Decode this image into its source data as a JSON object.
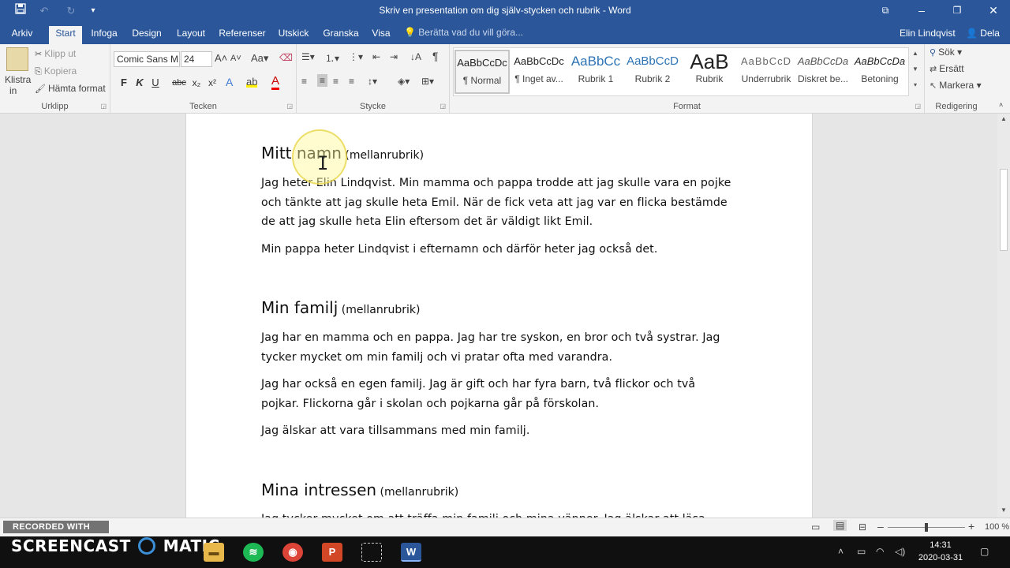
{
  "window": {
    "title": "Skriv en presentation om dig själv-stycken och rubrik - Word",
    "save_icon": "save-icon",
    "undo_icon": "undo-icon",
    "redo_icon": "redo-icon"
  },
  "tabs": [
    {
      "label": "Arkiv"
    },
    {
      "label": "Start"
    },
    {
      "label": "Infoga"
    },
    {
      "label": "Design"
    },
    {
      "label": "Layout"
    },
    {
      "label": "Referenser"
    },
    {
      "label": "Utskick"
    },
    {
      "label": "Granska"
    },
    {
      "label": "Visa"
    }
  ],
  "tellme": "Berätta vad du vill göra...",
  "user": {
    "name": "Elin Lindqvist",
    "share_label": "Dela"
  },
  "ribbon": {
    "clipboard": {
      "paste_label": "Klistra",
      "paste_sub": "in",
      "cut": "Klipp ut",
      "copy": "Kopiera",
      "format_painter": "Hämta format",
      "group": "Urklipp"
    },
    "font": {
      "name": "Comic Sans M",
      "size": "24",
      "group": "Tecken",
      "bold": "F",
      "italic": "K",
      "underline": "U",
      "strike": "abc",
      "subscript": "x₂",
      "superscript": "x²"
    },
    "paragraph": {
      "group": "Stycke"
    },
    "styles": {
      "group": "Format",
      "items": [
        {
          "preview": "AaBbCcDc",
          "name": "¶ Normal"
        },
        {
          "preview": "AaBbCcDc",
          "name": "¶ Inget av..."
        },
        {
          "preview": "AaBbCc",
          "name": "Rubrik 1"
        },
        {
          "preview": "AaBbCcD",
          "name": "Rubrik 2"
        },
        {
          "preview": "AaB",
          "name": "Rubrik"
        },
        {
          "preview": "AaBbCcD",
          "name": "Underrubrik"
        },
        {
          "preview": "AaBbCcDa",
          "name": "Diskret be..."
        },
        {
          "preview": "AaBbCcDa",
          "name": "Betoning"
        }
      ]
    },
    "editing": {
      "search": "Sök",
      "replace": "Ersätt",
      "select": "Markera",
      "group": "Redigering"
    }
  },
  "document": {
    "sections": [
      {
        "heading": "Mitt namn",
        "sub": " (mellanrubrik)",
        "paragraphs": [
          "Jag heter Elin Lindqvist. Min mamma och pappa trodde att jag skulle vara en pojke och tänkte att jag skulle heta Emil. När de fick veta att jag var en flicka bestämde de att jag skulle heta Elin eftersom det är väldigt likt Emil.",
          "Min pappa heter Lindqvist i efternamn och därför heter jag också det."
        ]
      },
      {
        "heading": "Min familj",
        "sub": " (mellanrubrik)",
        "paragraphs": [
          "Jag har en mamma och en pappa. Jag har tre syskon, en bror och två systrar. Jag tycker mycket om min familj och vi pratar ofta med varandra.",
          "Jag har också en egen familj. Jag är gift och har fyra barn, två flickor och två pojkar. Flickorna går i skolan och pojkarna går på förskolan.",
          "Jag älskar att vara tillsammans med min familj."
        ]
      },
      {
        "heading": "Mina intressen",
        "sub": " (mellanrubrik)",
        "paragraphs": [
          "Jag tycker mycket om att träffa min familj och mina vänner. Jag älskar att läsa"
        ]
      }
    ]
  },
  "status": {
    "watermark": "RECORDED WITH",
    "zoom": "100 %",
    "zoom_fraction": 0.5
  },
  "taskbar": {
    "brand": "SCREENCAST",
    "brand2": "MATIC",
    "time": "14:31",
    "date": "2020-03-31"
  }
}
